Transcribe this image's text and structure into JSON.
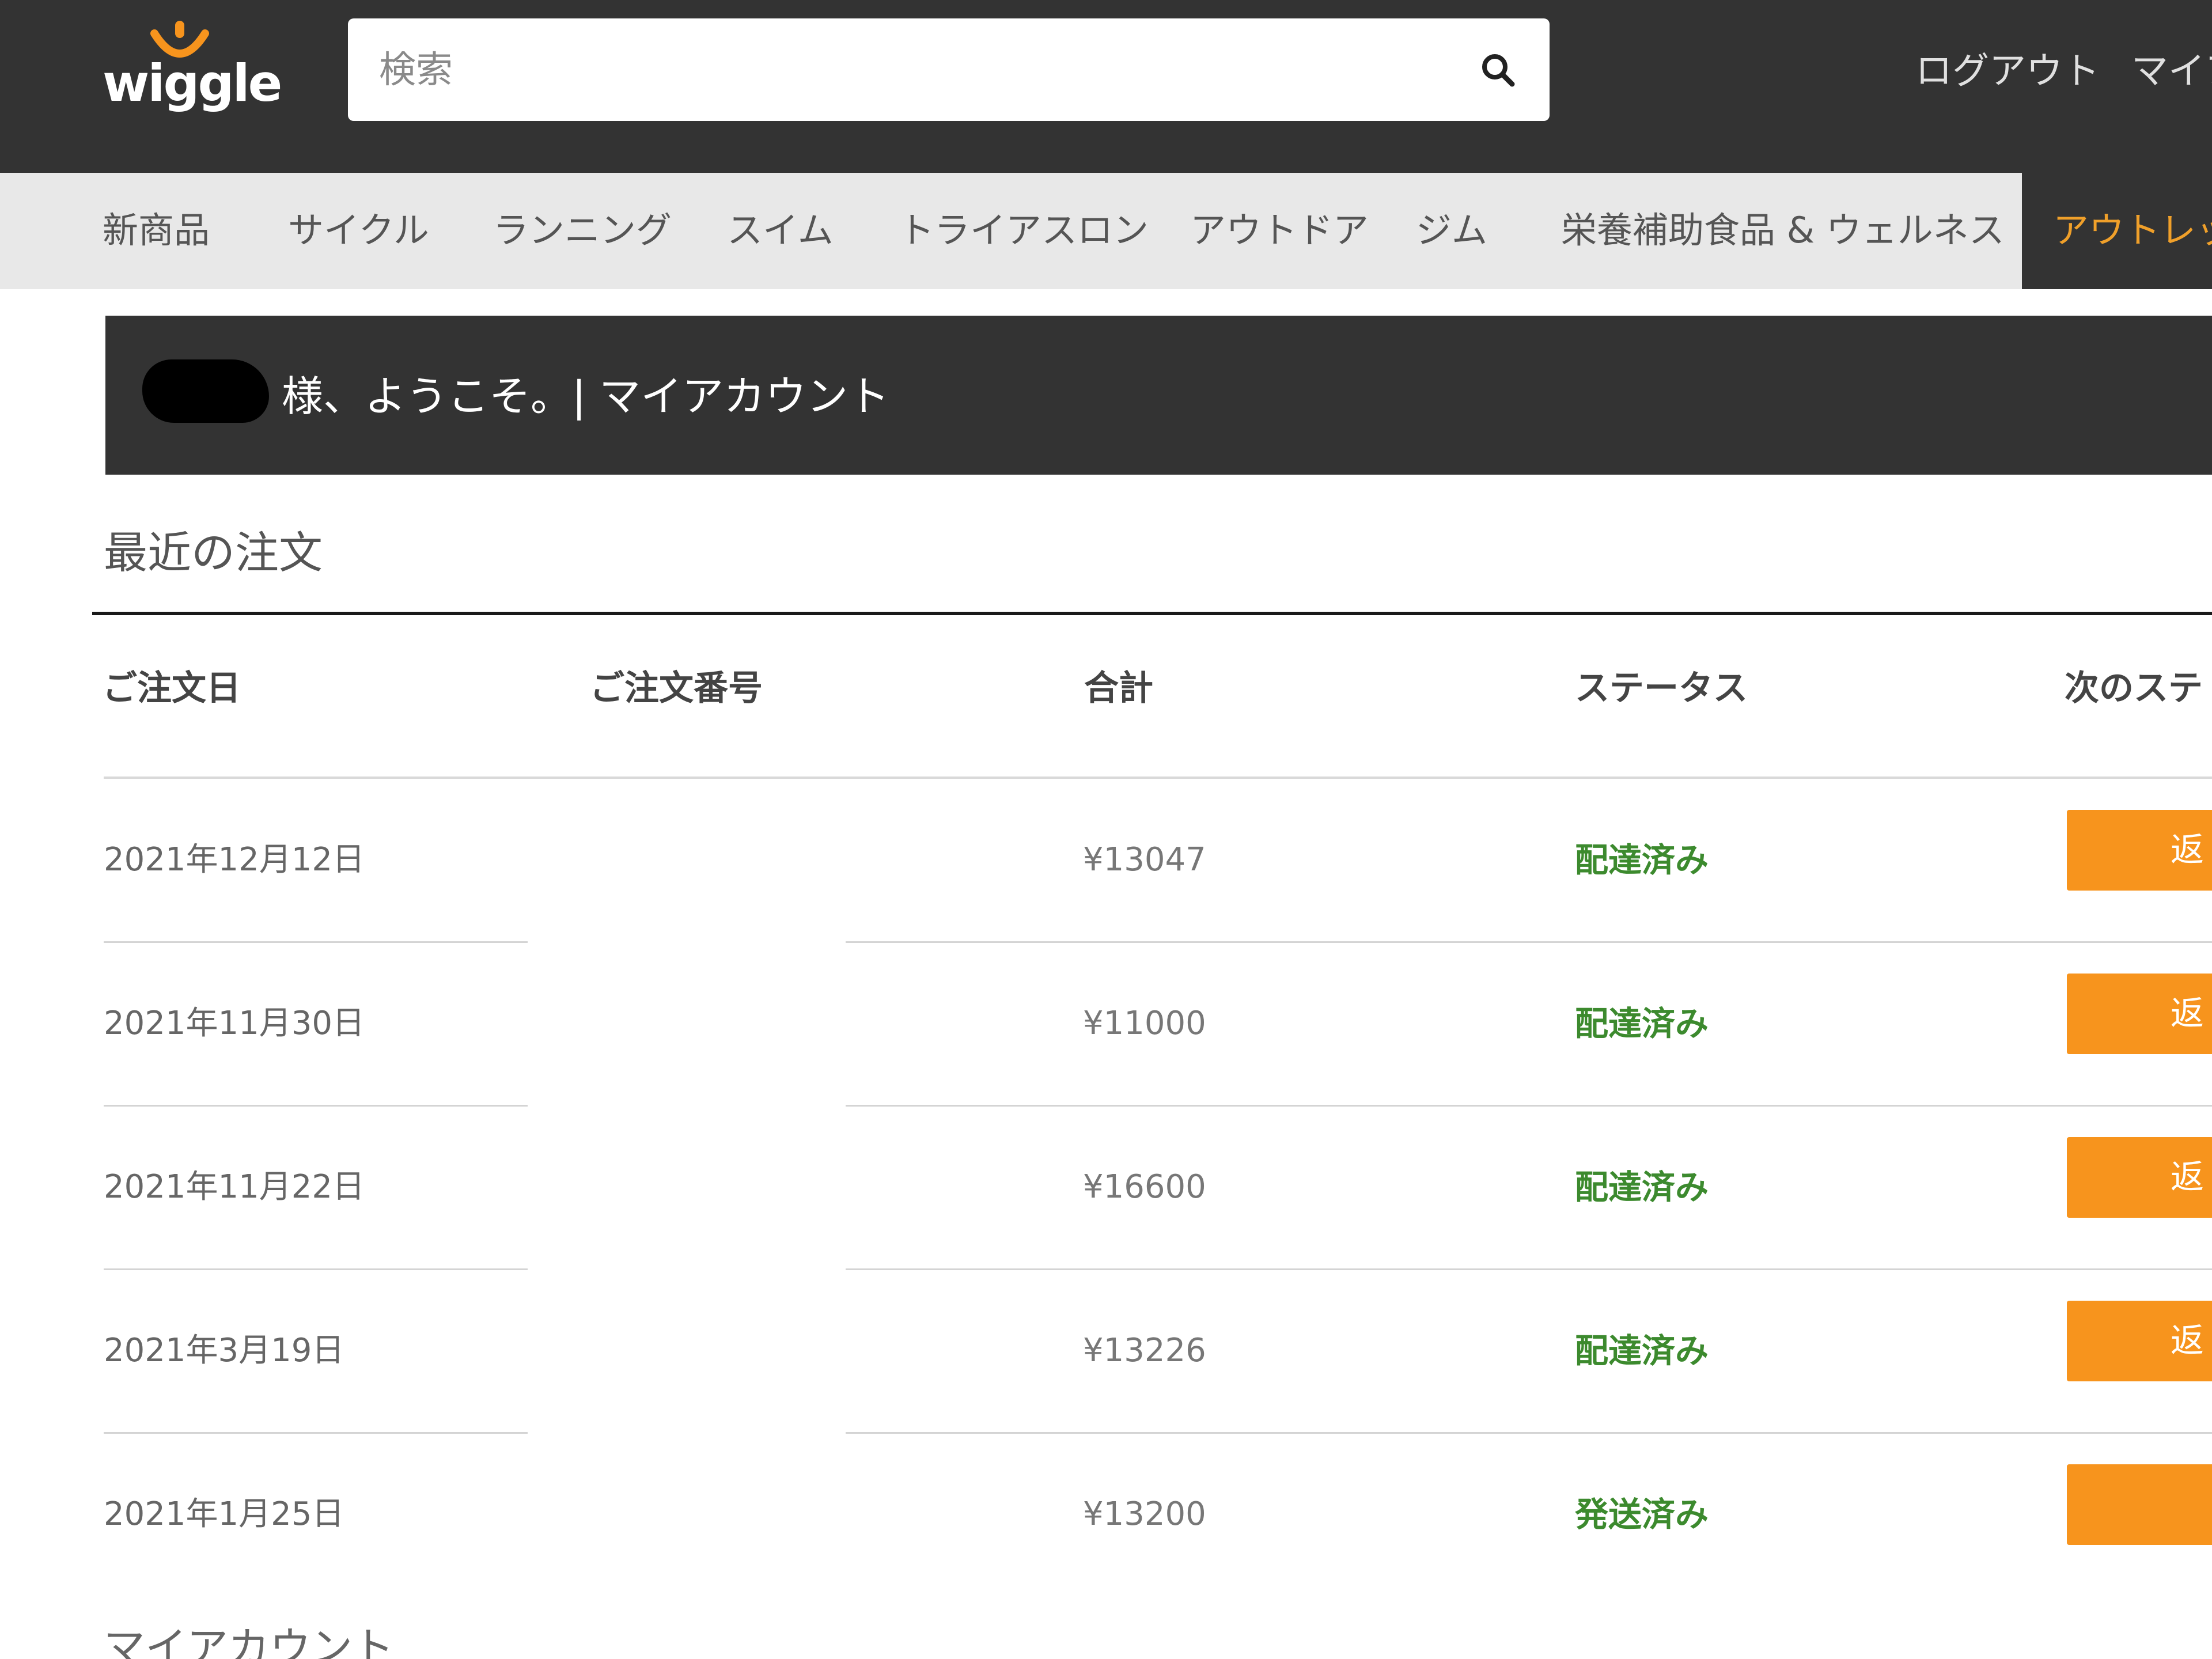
{
  "header": {
    "logo_text": "wiggle",
    "search_placeholder": "検索",
    "logout_label": "ログアウト",
    "my_account_label": "マイア"
  },
  "nav": {
    "items": [
      "新商品",
      "サイクル",
      "ランニング",
      "スイム",
      "トライアスロン",
      "アウトドア",
      "ジム",
      "栄養補助食品 & ウェルネス"
    ],
    "outlet_label": "アウトレット"
  },
  "welcome": {
    "text": "様、ようこそ。| マイアカウント"
  },
  "orders": {
    "title": "最近の注文",
    "columns": {
      "date": "ご注文日",
      "order_no": "ご注文番号",
      "total": "合計",
      "status": "ステータス",
      "next_step": "次のステ"
    },
    "rows": [
      {
        "date": "2021年12月12日",
        "total": "¥13047",
        "status": "配達済み",
        "action": "返"
      },
      {
        "date": "2021年11月30日",
        "total": "¥11000",
        "status": "配達済み",
        "action": "返"
      },
      {
        "date": "2021年11月22日",
        "total": "¥16600",
        "status": "配達済み",
        "action": "返"
      },
      {
        "date": "2021年3月19日",
        "total": "¥13226",
        "status": "配達済み",
        "action": "返"
      },
      {
        "date": "2021年1月25日",
        "total": "¥13200",
        "status": "発送済み",
        "action": ""
      }
    ]
  },
  "footer_section": {
    "title": "マイアカウント"
  },
  "colors": {
    "header_bg": "#333333",
    "nav_bg": "#e8e8e8",
    "accent_orange": "#f7941d",
    "outlet_text": "#f0a02a",
    "status_green": "#3c8a2e"
  }
}
